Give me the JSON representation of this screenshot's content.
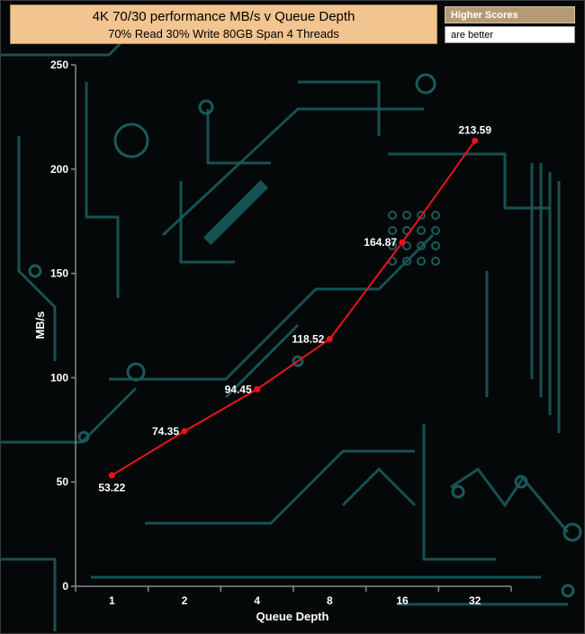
{
  "chart_data": {
    "type": "line",
    "title": "4K 70/30 performance MB/s v Queue Depth",
    "subtitle": "70% Read 30% Write 80GB Span 4 Threads",
    "xlabel": "Queue Depth",
    "ylabel": "MB/s",
    "categories": [
      "1",
      "2",
      "4",
      "8",
      "16",
      "32"
    ],
    "series": [
      {
        "values": [
          53.22,
          74.35,
          94.45,
          118.52,
          164.87,
          213.59
        ]
      }
    ],
    "data_labels": [
      "53.22",
      "74.35",
      "94.45",
      "118.52",
      "164.87",
      "213.59"
    ],
    "ylim": [
      0,
      250
    ],
    "yticks": [
      0,
      50,
      100,
      150,
      200,
      250
    ],
    "ytick_labels": [
      "0",
      "50",
      "100",
      "150",
      "200",
      "250"
    ],
    "grid": false,
    "line_color": "#e8141c",
    "background_color": "#050808",
    "circuit_color": "#1a5a5c"
  },
  "badge": {
    "line1": "Higher Scores",
    "line2": "are better"
  }
}
